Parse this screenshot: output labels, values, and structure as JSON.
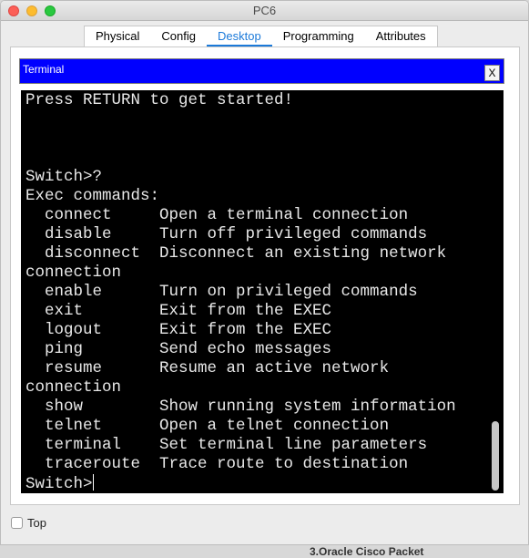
{
  "window": {
    "title": "PC6"
  },
  "tabs": [
    {
      "label": "Physical"
    },
    {
      "label": "Config"
    },
    {
      "label": "Desktop",
      "active": true
    },
    {
      "label": "Programming"
    },
    {
      "label": "Attributes"
    }
  ],
  "terminal": {
    "header": "Terminal",
    "close_label": "X",
    "lines": [
      "Press RETURN to get started!",
      "",
      "",
      "",
      "Switch>?",
      "Exec commands:",
      "  connect     Open a terminal connection",
      "  disable     Turn off privileged commands",
      "  disconnect  Disconnect an existing network",
      "connection",
      "  enable      Turn on privileged commands",
      "  exit        Exit from the EXEC",
      "  logout      Exit from the EXEC",
      "  ping        Send echo messages",
      "  resume      Resume an active network",
      "connection",
      "  show        Show running system information",
      "  telnet      Open a telnet connection",
      "  terminal    Set terminal line parameters",
      "  traceroute  Trace route to destination"
    ],
    "prompt": "Switch>"
  },
  "footer": {
    "top_label": "Top",
    "top_checked": false
  },
  "background_peek": "3.Oracle Cisco Packet",
  "colors": {
    "accent": "#1c7ad9",
    "terminal_header": "#0000ff",
    "terminal_bg": "#000000",
    "terminal_fg": "#e8e8e8"
  }
}
